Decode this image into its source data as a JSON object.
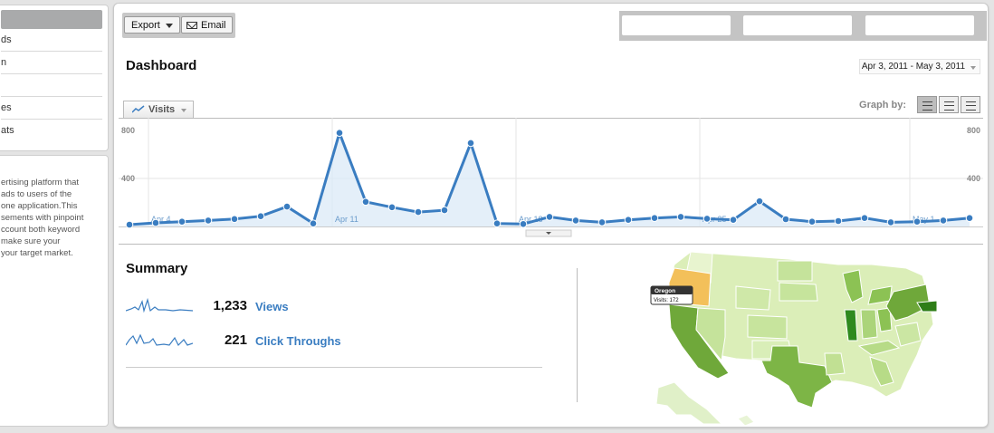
{
  "sidebar": {
    "active_label": "",
    "items": [
      {
        "label": "ds"
      },
      {
        "label": "n"
      },
      {
        "label": ""
      },
      {
        "label": "es"
      },
      {
        "label": "ats"
      }
    ],
    "description_lines": [
      "ertising platform that",
      " ads to users of the",
      "one application.This",
      "sements with pinpoint",
      "ccount both keyword",
      "make sure your",
      "your target market."
    ]
  },
  "toolbar": {
    "export_label": "Export",
    "email_label": "Email"
  },
  "page": {
    "title": "Dashboard",
    "date_range": "Apr 3, 2011 - May 3, 2011"
  },
  "graph_by": {
    "label": "Graph by:"
  },
  "metric_tab": {
    "label": "Visits"
  },
  "summary": {
    "title": "Summary",
    "stats": [
      {
        "value": "1,233",
        "label": "Views"
      },
      {
        "value": "221",
        "label": "Click Throughs"
      }
    ]
  },
  "map": {
    "tooltip_state": "Oregon",
    "tooltip_value": "Visits: 172",
    "highlight_color": "#f3c05a"
  },
  "chart_data": {
    "type": "area",
    "series": [
      {
        "name": "Visits",
        "color": "#3a7dc1",
        "values": [
          15,
          30,
          40,
          50,
          62,
          85,
          165,
          25,
          780,
          205,
          160,
          120,
          135,
          695,
          25,
          20,
          80,
          50,
          35,
          55,
          70,
          80,
          65,
          55,
          210,
          60,
          40,
          45,
          70,
          35,
          40,
          50,
          70
        ]
      }
    ],
    "x_tick_labels": [
      {
        "label": "Apr 4",
        "index": 1
      },
      {
        "label": "Apr 11",
        "index": 8
      },
      {
        "label": "Apr 18",
        "index": 15
      },
      {
        "label": "Apr 25",
        "index": 22
      },
      {
        "label": "May 1",
        "index": 30
      }
    ],
    "y_ticks": [
      "800",
      "400"
    ],
    "ylim": [
      0,
      800
    ],
    "grid": true
  }
}
